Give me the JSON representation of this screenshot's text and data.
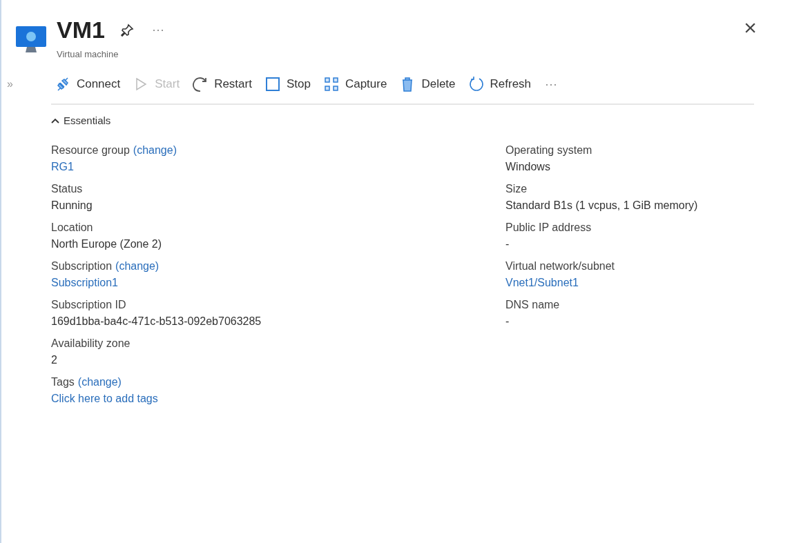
{
  "header": {
    "title": "VM1",
    "subtitle": "Virtual machine",
    "more": "···",
    "close": "×"
  },
  "sidebar_toggle": "»",
  "toolbar": {
    "actions": [
      {
        "label": "Connect",
        "disabled": false
      },
      {
        "label": "Start",
        "disabled": true
      },
      {
        "label": "Restart",
        "disabled": false
      },
      {
        "label": "Stop",
        "disabled": false
      },
      {
        "label": "Capture",
        "disabled": false
      },
      {
        "label": "Delete",
        "disabled": false
      },
      {
        "label": "Refresh",
        "disabled": false
      }
    ],
    "more": "···"
  },
  "essentials": {
    "label": "Essentials",
    "expanded": true,
    "left": [
      {
        "label": "Resource group",
        "change": "(change)",
        "value": "RG1",
        "kind": "link"
      },
      {
        "label": "Status",
        "value": "Running",
        "kind": "text"
      },
      {
        "label": "Location",
        "value": "North Europe (Zone 2)",
        "kind": "text"
      },
      {
        "label": "Subscription",
        "change": "(change)",
        "value": "Subscription1",
        "kind": "link"
      },
      {
        "label": "Subscription ID",
        "value": "169d1bba-ba4c-471c-b513-092eb7063285",
        "kind": "text"
      },
      {
        "label": "Availability zone",
        "value": "2",
        "kind": "text"
      },
      {
        "label": "Tags",
        "change": "(change)",
        "value": "Click here to add tags",
        "kind": "link"
      }
    ],
    "right": [
      {
        "label": "Operating system",
        "value": "Windows",
        "kind": "text"
      },
      {
        "label": "Size",
        "value": "Standard B1s (1 vcpus, 1 GiB memory)",
        "kind": "text"
      },
      {
        "label": "Public IP address",
        "value": "-",
        "kind": "text"
      },
      {
        "label": "Virtual network/subnet",
        "value": "Vnet1/Subnet1",
        "kind": "link"
      },
      {
        "label": "DNS name",
        "value": "-",
        "kind": "text"
      }
    ]
  }
}
